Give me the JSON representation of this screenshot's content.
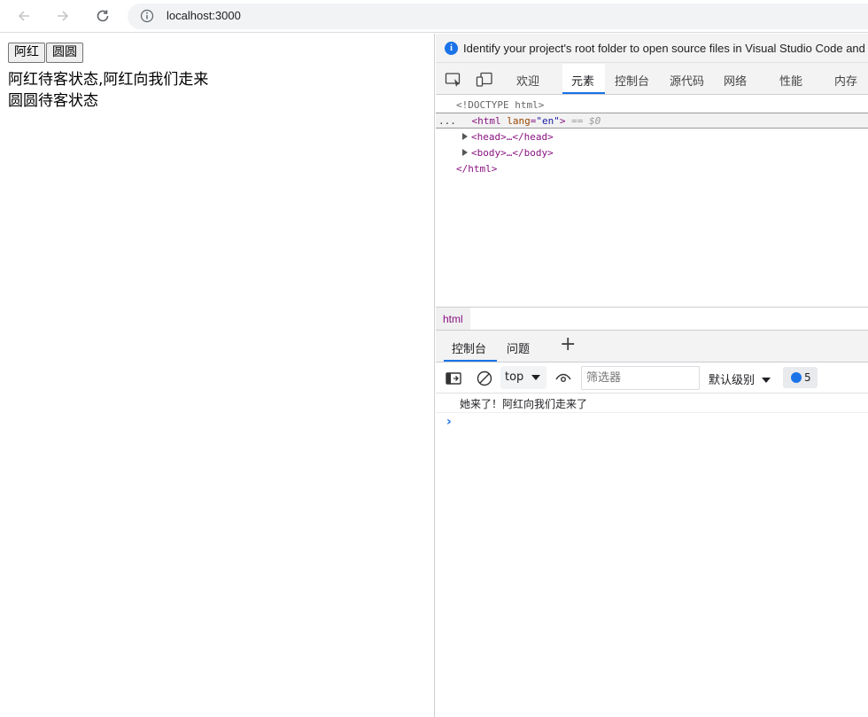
{
  "browser": {
    "url": "localhost:3000",
    "back_icon": "arrow-left-icon",
    "forward_icon": "arrow-right-icon",
    "reload_icon": "reload-icon"
  },
  "page": {
    "buttons": [
      "阿红",
      "圆圆"
    ],
    "status_lines": [
      "阿红待客状态,阿红向我们走来",
      "圆圆待客状态"
    ]
  },
  "devtools": {
    "banner": "Identify your project's root folder to open source files in Visual Studio Code and",
    "tabs": [
      "欢迎",
      "元素",
      "控制台",
      "源代码",
      "网络",
      "性能",
      "内存"
    ],
    "active_tab": "元素",
    "dom": {
      "doctype": "<!DOCTYPE html>",
      "html_open": "<html",
      "lang_attr": "lang",
      "lang_val": "\"en\"",
      "html_close_bracket": ">",
      "selected_marker": "== $0",
      "head": "<head>…</head>",
      "body": "<body>…</body>",
      "html_end": "</html>",
      "ellipsis": "..."
    },
    "breadcrumb": "html",
    "drawer_tabs": [
      "控制台",
      "问题"
    ],
    "console": {
      "context": "top",
      "filter_placeholder": "筛选器",
      "level": "默认级别",
      "message_count": "5",
      "messages": [
        "她来了！阿红向我们走来了"
      ],
      "prompt": "›"
    }
  }
}
